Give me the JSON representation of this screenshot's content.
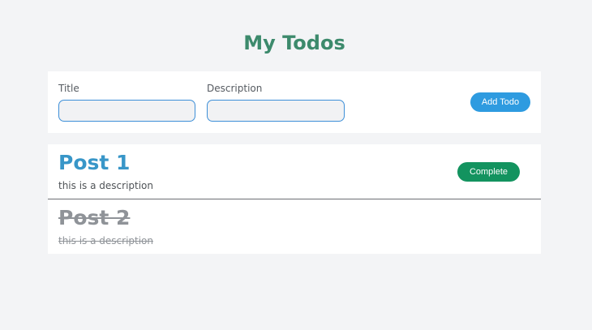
{
  "app": {
    "title": "My Todos"
  },
  "form": {
    "title_label": "Title",
    "title_value": "",
    "description_label": "Description",
    "description_value": "",
    "add_button_label": "Add Todo"
  },
  "todos": [
    {
      "title": "Post 1",
      "description": "this is a description",
      "completed": false,
      "complete_button_label": "Complete"
    },
    {
      "title": "Post 2",
      "description": "this is a description",
      "completed": true
    }
  ],
  "colors": {
    "page_background": "#f3f4f6",
    "title": "#3c8a6c",
    "todo_title": "#3896c8",
    "add_button": "#2e9be0",
    "complete_button": "#13935f",
    "completed_text": "#8f9398"
  }
}
